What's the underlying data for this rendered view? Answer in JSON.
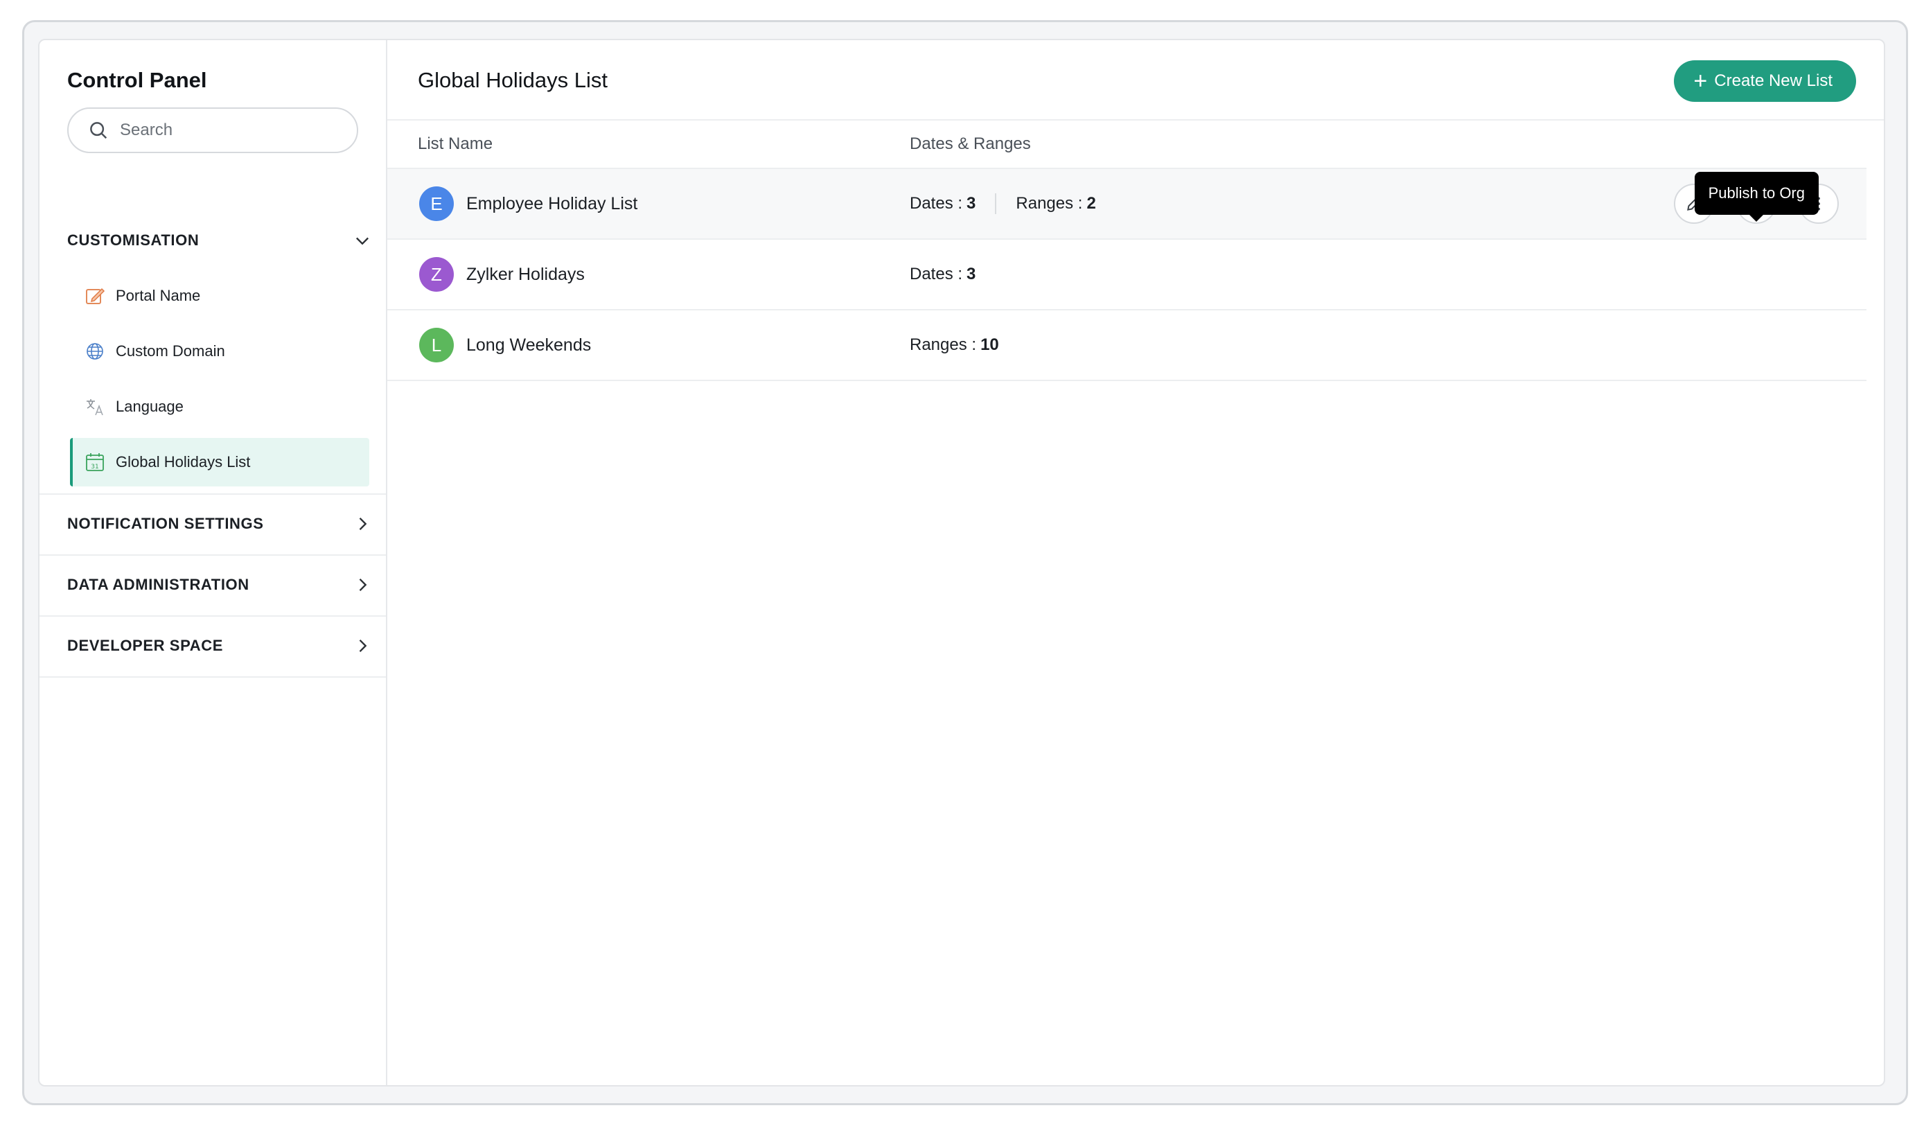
{
  "sidebar": {
    "title": "Control Panel",
    "search_placeholder": "Search",
    "sections": [
      {
        "label": "CUSTOMISATION",
        "expanded": true,
        "items": [
          {
            "label": "Portal Name",
            "icon": "portal-name-icon"
          },
          {
            "label": "Custom Domain",
            "icon": "globe-icon"
          },
          {
            "label": "Language",
            "icon": "translate-icon"
          },
          {
            "label": "Global Holidays List",
            "icon": "calendar-icon",
            "active": true
          }
        ]
      },
      {
        "label": "NOTIFICATION SETTINGS",
        "expanded": false
      },
      {
        "label": "DATA ADMINISTRATION",
        "expanded": false
      },
      {
        "label": "DEVELOPER SPACE",
        "expanded": false
      }
    ]
  },
  "main": {
    "title": "Global Holidays List",
    "create_button_label": "Create New List",
    "columns": {
      "name": "List Name",
      "dates": "Dates & Ranges"
    },
    "rows": [
      {
        "initial": "E",
        "avatar_color": "#4a86e8",
        "name": "Employee Holiday List",
        "dates_label": "Dates :",
        "dates_value": "3",
        "ranges_label": "Ranges :",
        "ranges_value": "2"
      },
      {
        "initial": "Z",
        "avatar_color": "#9b59d0",
        "name": "Zylker Holidays",
        "dates_label": "Dates :",
        "dates_value": "3"
      },
      {
        "initial": "L",
        "avatar_color": "#5cb85c",
        "name": "Long Weekends",
        "ranges_label": "Ranges :",
        "ranges_value": "10"
      }
    ],
    "tooltip": "Publish to Org"
  },
  "colors": {
    "accent": "#219d80",
    "active_bg": "#e6f6f2"
  }
}
